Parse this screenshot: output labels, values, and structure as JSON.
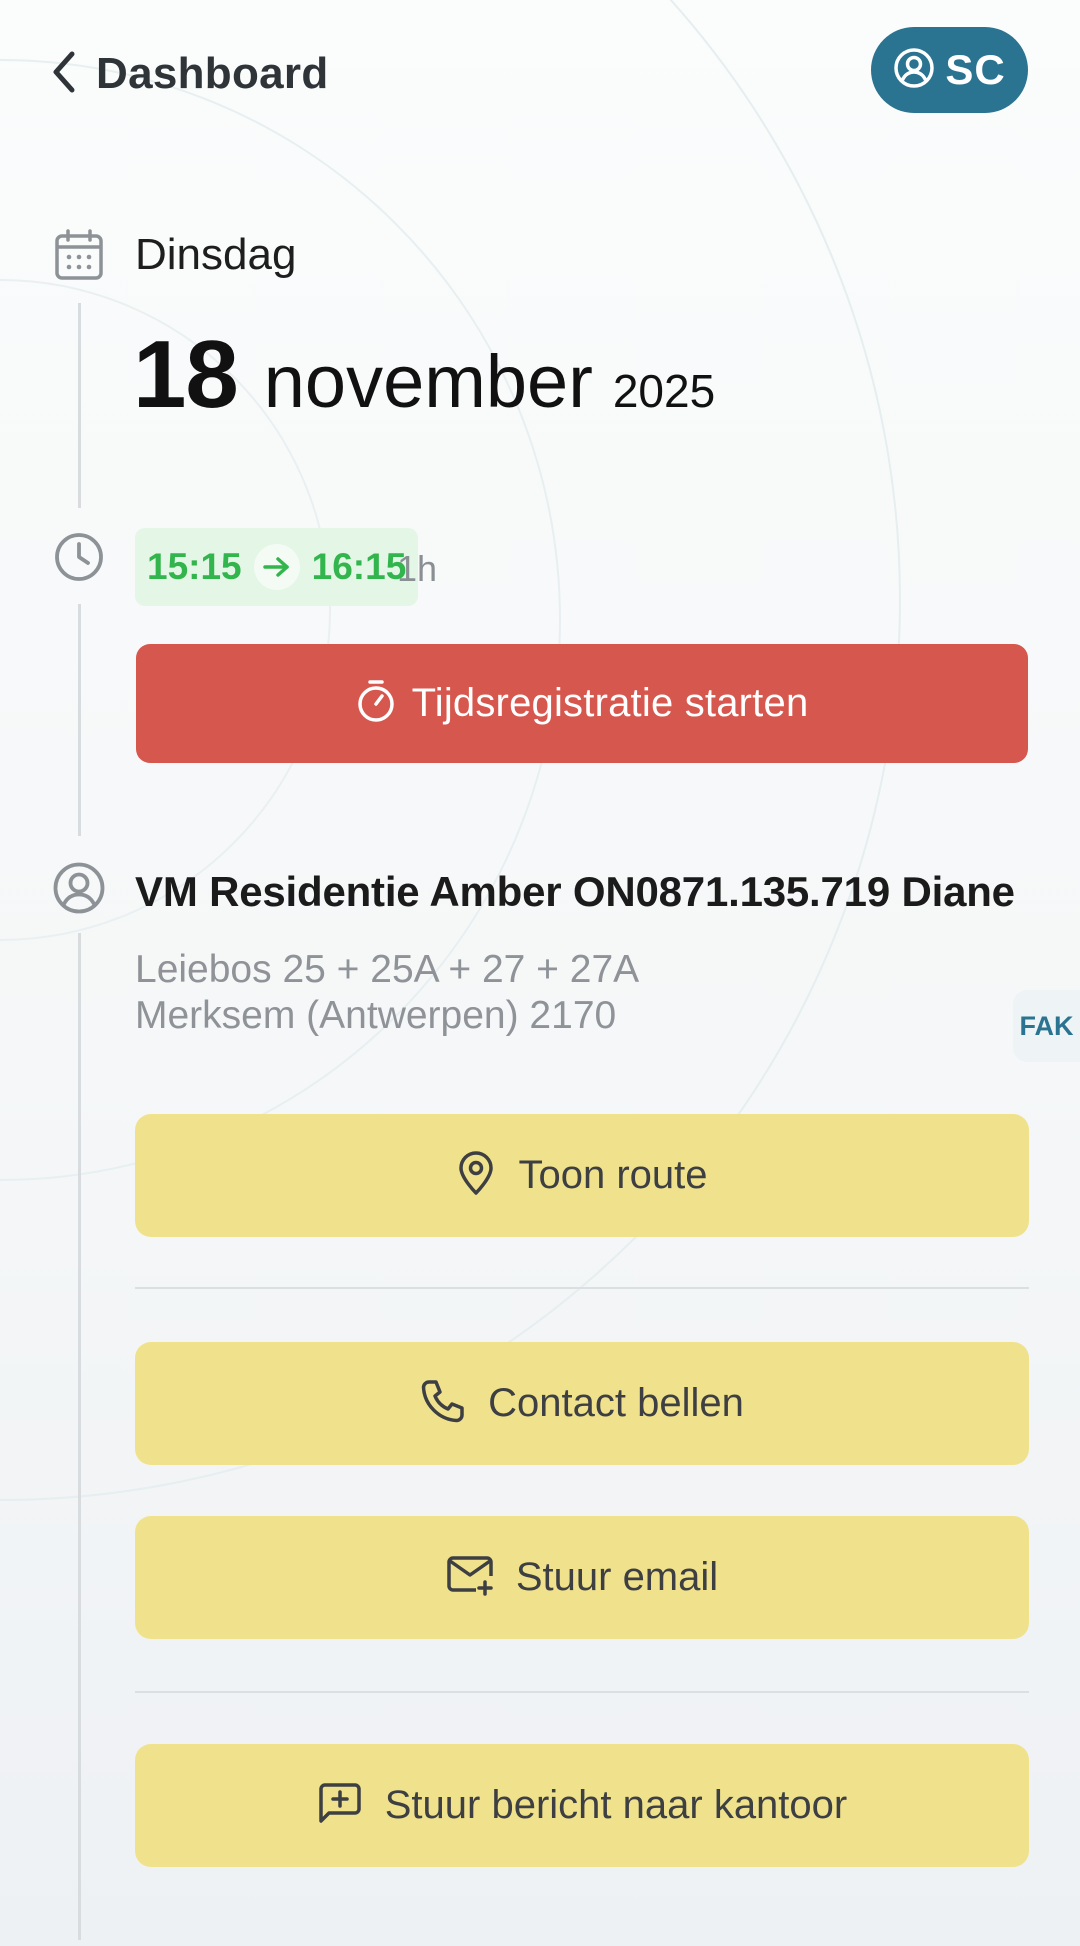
{
  "header": {
    "back_label": "Dashboard",
    "user_initials": "SC"
  },
  "date": {
    "weekday": "Dinsdag",
    "day": "18",
    "month": "november",
    "year": "2025"
  },
  "time": {
    "start": "15:15",
    "end": "16:15",
    "duration": "1h"
  },
  "actions": {
    "start_timer_label": "Tijdsregistratie starten",
    "route_label": "Toon route",
    "call_label": "Contact bellen",
    "email_label": "Stuur email",
    "message_label": "Stuur bericht naar kantoor"
  },
  "client": {
    "name": "VM Residentie Amber ON0871.135.719 Diane",
    "address_line1": "Leiebos 25 + 25A + 27 + 27A",
    "address_line2": "Merksem (Antwerpen) 2170"
  },
  "side_tab": {
    "label": "FAK"
  },
  "colors": {
    "accent": "#2a7391",
    "danger": "#d6574d",
    "action": "#f0e28c",
    "time_green": "#33b54d",
    "time_bg": "#e4f6e6"
  },
  "icons": {
    "back": "chevron-left-icon",
    "user": "user-circle-icon",
    "calendar": "calendar-icon",
    "clock": "clock-icon",
    "timer": "stopwatch-icon",
    "client": "user-circle-icon",
    "route": "map-pin-icon",
    "call": "phone-icon",
    "email": "mail-plus-icon",
    "message": "message-plus-icon"
  }
}
